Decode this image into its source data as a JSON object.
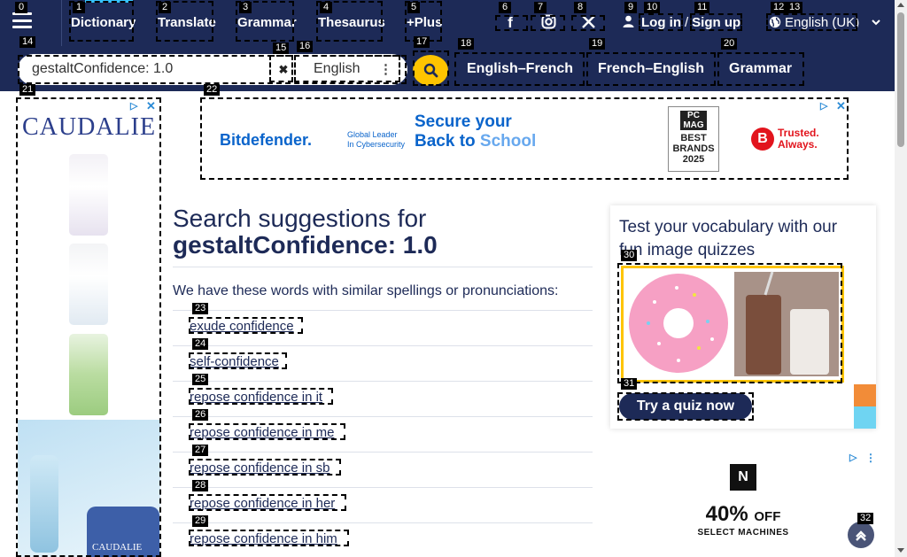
{
  "nav": {
    "menu_icon": "hamburger-icon",
    "links": [
      "Dictionary",
      "Translate",
      "Grammar",
      "Thesaurus",
      "+Plus"
    ],
    "social_icons": [
      "facebook-icon",
      "instagram-icon",
      "x-icon"
    ],
    "login_label": "Log in",
    "auth_sep": "/",
    "signup_label": "Sign up",
    "language_label": "English (UK)",
    "accent_color": "#36c4ff",
    "background_color": "#1d2a57"
  },
  "search": {
    "query": "gestaltConfidence: 1.0",
    "language": "English",
    "search_button_color": "#fec400",
    "dictionary_links": [
      "English–French",
      "French–English",
      "Grammar"
    ]
  },
  "ads": {
    "left_brand": "CAUDALIE",
    "left_photo_brand": "CAUDALIE",
    "top_brand": "Bitdefender.",
    "top_tagline_1": "Global Leader",
    "top_tagline_2": "In Cybersecurity",
    "top_headline_1": "Secure your",
    "top_headline_2a": "Back to",
    "top_headline_2b": "School",
    "top_badge_pc": "PC MAG",
    "top_badge_text": "BEST BRANDS 2025",
    "top_trusted_1": "Trusted.",
    "top_trusted_2": "Always.",
    "right_logo": "N",
    "right_offer": "40%",
    "right_offer_suffix": "OFF",
    "right_sub": "SELECT MACHINES"
  },
  "content": {
    "heading_line1": "Search suggestions for",
    "heading_line2": "gestaltConfidence: 1.0",
    "similar_note": "We have these words with similar spellings or pronunciations:",
    "suggestions": [
      "exude confidence",
      "self-confidence",
      "repose confidence in it",
      "repose confidence in me",
      "repose confidence in sb",
      "repose confidence in her",
      "repose confidence in him"
    ]
  },
  "quiz": {
    "title": "Test your vocabulary with our fun image quizzes",
    "button_label": "Try a quiz now"
  },
  "marks": [
    "0",
    "1",
    "2",
    "3",
    "4",
    "5",
    "6",
    "7",
    "8",
    "9",
    "10",
    "11",
    "12",
    "13",
    "14",
    "15",
    "16",
    "17",
    "18",
    "19",
    "20",
    "21",
    "22",
    "23",
    "24",
    "25",
    "26",
    "27",
    "28",
    "29",
    "30",
    "31",
    "32"
  ]
}
